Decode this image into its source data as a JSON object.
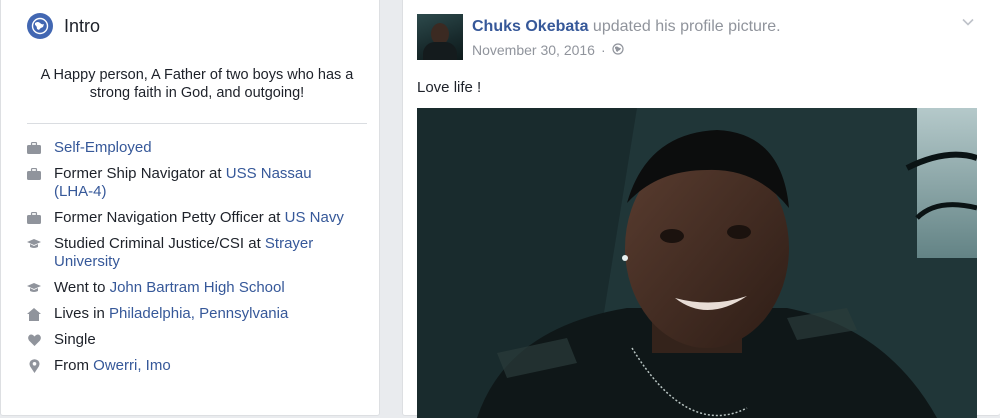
{
  "intro": {
    "title": "Intro",
    "bio": "A Happy person, A Father of two boys who has a strong faith in God, and outgoing!",
    "items": [
      {
        "icon": "briefcase-icon",
        "prefix": "",
        "link": "Self-Employed",
        "suffix": ""
      },
      {
        "icon": "briefcase-icon",
        "prefix": "Former Ship Navigator at ",
        "link": "USS Nassau (LHA-4)",
        "suffix": ""
      },
      {
        "icon": "briefcase-icon",
        "prefix": "Former Navigation Petty Officer at ",
        "link": "US Navy",
        "suffix": ""
      },
      {
        "icon": "graduation-cap-icon",
        "prefix": "Studied Criminal Justice/CSI at ",
        "link": "Strayer University",
        "suffix": ""
      },
      {
        "icon": "graduation-cap-icon",
        "prefix": "Went to ",
        "link": "John Bartram High School",
        "suffix": ""
      },
      {
        "icon": "home-icon",
        "prefix": "Lives in ",
        "link": "Philadelphia, Pennsylvania",
        "suffix": ""
      },
      {
        "icon": "heart-icon",
        "prefix": "Single",
        "link": "",
        "suffix": ""
      },
      {
        "icon": "location-pin-icon",
        "prefix": "From ",
        "link": "Owerri, Imo",
        "suffix": ""
      }
    ]
  },
  "post": {
    "author": "Chuks Okebata",
    "action": " updated his profile picture.",
    "date": "November 30, 2016",
    "separator": "·",
    "caption": "Love life !"
  },
  "colors": {
    "link": "#365899",
    "meta": "#90949c",
    "accent": "#4267b2",
    "background": "#e9ebee"
  }
}
